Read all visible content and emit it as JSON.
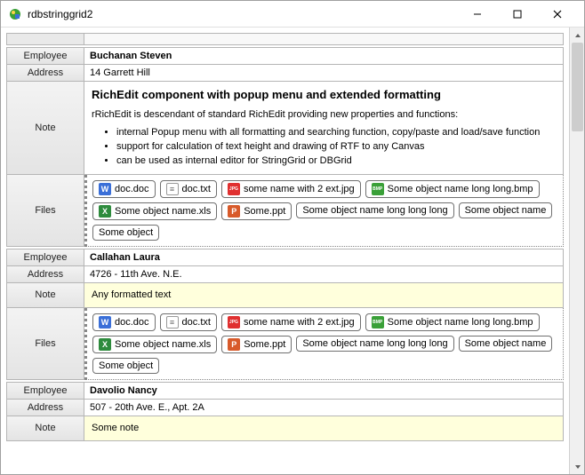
{
  "window": {
    "title": "rdbstringgrid2"
  },
  "labels": {
    "employee": "Employee",
    "address": "Address",
    "note": "Note",
    "files": "Files"
  },
  "records": [
    {
      "employee": "Buchanan Steven",
      "address": "14 Garrett Hill",
      "note": {
        "type": "rich",
        "title": "RichEdit component with popup menu and extended formatting",
        "para": "rRichEdit is descendant of standard RichEdit providing new properties and functions:",
        "bullets": [
          "internal Popup menu with all formatting and searching function, copy/paste and load/save function",
          "support for calculation of text height and drawing of RTF to any Canvas",
          "can be used as internal editor for StringGrid or DBGrid"
        ]
      },
      "files": [
        {
          "name": "doc.doc",
          "icon": "doc"
        },
        {
          "name": "doc.txt",
          "icon": "txt"
        },
        {
          "name": "some name with 2 ext.jpg",
          "icon": "jpg"
        },
        {
          "name": "Some object name long long.bmp",
          "icon": "bmp"
        },
        {
          "name": "Some object name.xls",
          "icon": "xls"
        },
        {
          "name": "Some.ppt",
          "icon": "ppt"
        },
        {
          "name": "Some object name long long long",
          "icon": "none"
        },
        {
          "name": "Some object name",
          "icon": "none"
        },
        {
          "name": "Some object",
          "icon": "none"
        }
      ]
    },
    {
      "employee": "Callahan Laura",
      "address": "4726 - 11th Ave. N.E.",
      "note": {
        "type": "plain",
        "text": "Any formatted text"
      },
      "files": [
        {
          "name": "doc.doc",
          "icon": "doc"
        },
        {
          "name": "doc.txt",
          "icon": "txt"
        },
        {
          "name": "some name with 2 ext.jpg",
          "icon": "jpg"
        },
        {
          "name": "Some object name long long.bmp",
          "icon": "bmp"
        },
        {
          "name": "Some object name.xls",
          "icon": "xls"
        },
        {
          "name": "Some.ppt",
          "icon": "ppt"
        },
        {
          "name": "Some object name long long long",
          "icon": "none"
        },
        {
          "name": "Some object name",
          "icon": "none"
        },
        {
          "name": "Some object",
          "icon": "none"
        }
      ]
    },
    {
      "employee": "Davolio Nancy",
      "address": "507 - 20th Ave. E., Apt. 2A",
      "note": {
        "type": "plain",
        "text": "Some note"
      },
      "files": []
    }
  ],
  "icons": {
    "doc": {
      "bg": "#3a6fd8",
      "fg": "#fff",
      "label": "W"
    },
    "txt": {
      "bg": "#ffffff",
      "fg": "#666",
      "label": "≡"
    },
    "jpg": {
      "bg": "#e03030",
      "fg": "#fff",
      "label": "JPG"
    },
    "bmp": {
      "bg": "#3aa038",
      "fg": "#fff",
      "label": "BMP"
    },
    "xls": {
      "bg": "#2e8b3d",
      "fg": "#fff",
      "label": "X"
    },
    "ppt": {
      "bg": "#d85a2a",
      "fg": "#fff",
      "label": "P"
    },
    "none": {
      "bg": "transparent",
      "fg": "#888",
      "label": ""
    }
  }
}
